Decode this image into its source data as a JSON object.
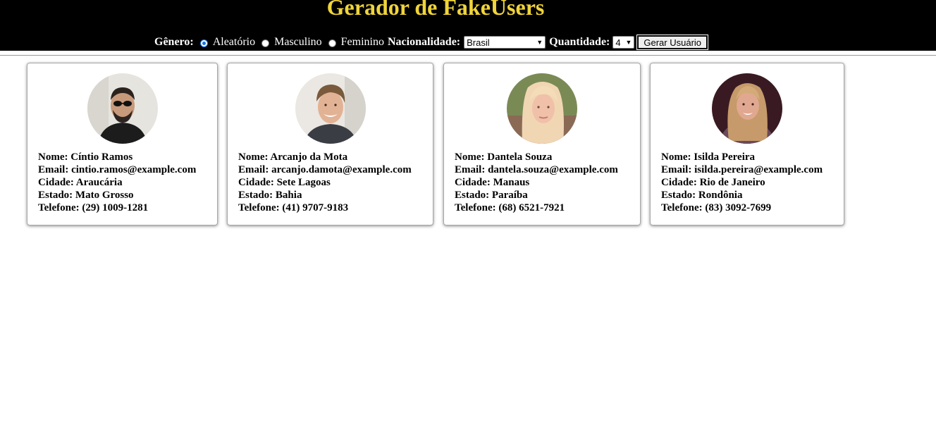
{
  "header": {
    "title": "Gerador de FakeUsers",
    "title_color": "#f0d43a",
    "background": "#000000"
  },
  "controls": {
    "genero_label": "Gênero:",
    "genero_options": [
      "Aleatório",
      "Masculino",
      "Feminino"
    ],
    "genero_selected": "Aleatório",
    "nacionalidade_label": "Nacionalidade:",
    "nacionalidade_value": "Brasil",
    "quantidade_label": "Quantidade:",
    "quantidade_value": "4",
    "gerar_button": "Gerar Usuário"
  },
  "users": [
    {
      "nome": "Nome: Cíntio Ramos",
      "email": "Email: cintio.ramos@example.com",
      "cidade": "Cidade: Araucária",
      "estado": "Estado: Mato Grosso",
      "telefone": "Telefone: (29) 1009-1281",
      "photo_icon": "man-with-sunglasses-photo"
    },
    {
      "nome": "Nome: Arcanjo da Mota",
      "email": "Email: arcanjo.damota@example.com",
      "cidade": "Cidade: Sete Lagoas",
      "estado": "Estado: Bahia",
      "telefone": "Telefone: (41) 9707-9183",
      "photo_icon": "smiling-young-man-photo"
    },
    {
      "nome": "Nome: Dantela Souza",
      "email": "Email: dantela.souza@example.com",
      "cidade": "Cidade: Manaus",
      "estado": "Estado: Paraíba",
      "telefone": "Telefone: (68) 6521-7921",
      "photo_icon": "blonde-woman-photo"
    },
    {
      "nome": "Nome: Isilda Pereira",
      "email": "Email: isilda.pereira@example.com",
      "cidade": "Cidade: Rio de Janeiro",
      "estado": "Estado: Rondônia",
      "telefone": "Telefone: (83) 3092-7699",
      "photo_icon": "blonde-woman-selfie-photo"
    }
  ]
}
